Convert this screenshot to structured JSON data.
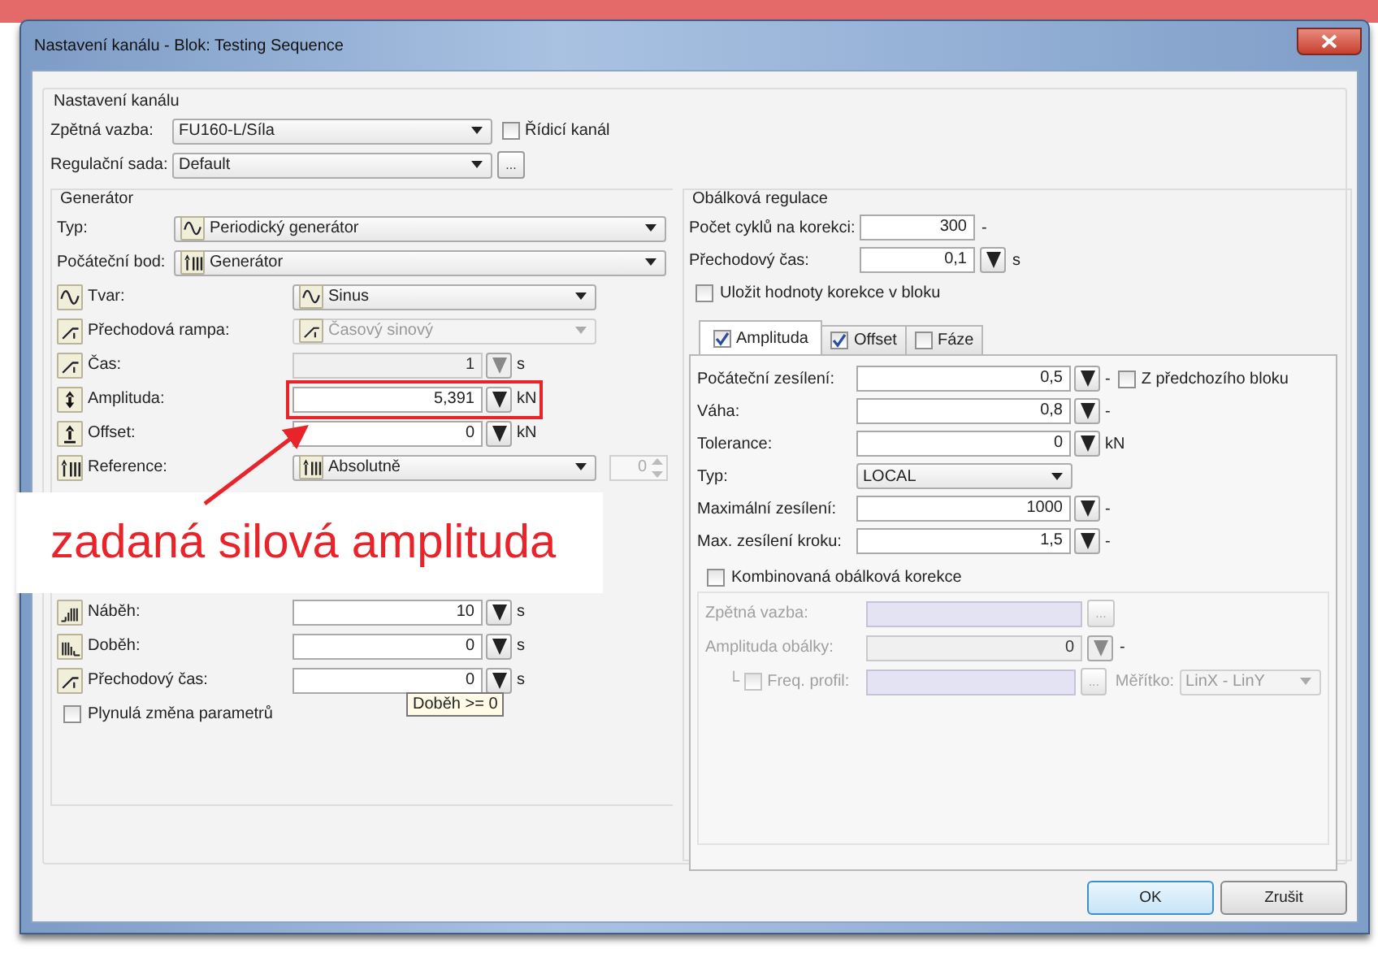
{
  "window": {
    "title": "Nastavení kanálu - Blok: Testing Sequence"
  },
  "channel": {
    "title": "Nastavení kanálu",
    "feedback": {
      "label": "Zpětná vazba:",
      "value": "FU160-L/Síla"
    },
    "control_channel": {
      "label": "Řídicí kanál",
      "checked": false
    },
    "control_set": {
      "label": "Regulační sada:",
      "value": "Default",
      "button": "..."
    }
  },
  "generator": {
    "title": "Generátor",
    "rows": [
      {
        "kind": "select",
        "label": "Typ:",
        "value": "Periodický generátor",
        "disabled": false,
        "highlighted": false
      },
      {
        "kind": "select",
        "label": "Počáteční bod:",
        "value": "Generátor",
        "disabled": false,
        "highlighted": false
      },
      {
        "kind": "select",
        "label": "Tvar:",
        "value": "Sinus",
        "disabled": false,
        "highlighted": false
      },
      {
        "kind": "select",
        "label": "Přechodová rampa:",
        "value": "Časový sinový",
        "disabled": true,
        "highlighted": false
      },
      {
        "kind": "number",
        "label": "Čas:",
        "value": "1",
        "unit": "s",
        "disabled": true,
        "highlighted": false
      },
      {
        "kind": "number",
        "label": "Amplituda:",
        "value": "5,391",
        "unit": "kN",
        "disabled": false,
        "highlighted": true
      },
      {
        "kind": "number",
        "label": "Offset:",
        "value": "0",
        "unit": "kN",
        "disabled": false,
        "highlighted": false
      },
      {
        "kind": "select",
        "label": "Reference:",
        "value": "Absolutně",
        "spinner": "0",
        "disabled": false,
        "highlighted": false
      }
    ],
    "rows_below": [
      {
        "kind": "number",
        "label": "Náběh:",
        "value": "10",
        "unit": "s",
        "disabled": false,
        "highlighted": false
      },
      {
        "kind": "number",
        "label": "Doběh:",
        "value": "0",
        "unit": "s",
        "disabled": false,
        "highlighted": false
      },
      {
        "kind": "number",
        "label": "Přechodový čas:",
        "value": "0",
        "unit": "s",
        "disabled": false,
        "highlighted": false
      }
    ],
    "tooltip": "Doběh >= 0",
    "smooth": {
      "label": "Plynulá změna parametrů",
      "checked": false
    }
  },
  "envelope": {
    "title": "Obálková regulace",
    "rows": [
      {
        "kind": "number",
        "label": "Počet cyklů na korekci:",
        "value": "300",
        "unit": "-",
        "spin": false
      },
      {
        "kind": "number",
        "label": "Přechodový čas:",
        "value": "0,1",
        "unit": "s",
        "spin": true
      }
    ],
    "save": {
      "label": "Uložit hodnoty korekce v bloku",
      "checked": false
    },
    "tabs": [
      {
        "label": "Amplituda",
        "checked": true,
        "selected": true
      },
      {
        "label": "Offset",
        "checked": true,
        "selected": false
      },
      {
        "label": "Fáze",
        "checked": false,
        "selected": false
      }
    ],
    "fields": [
      {
        "kind": "number",
        "label": "Počáteční zesílení:",
        "value": "0,5",
        "unit": "-",
        "option": {
          "label": "Z předchozího bloku",
          "checked": false
        }
      },
      {
        "kind": "number",
        "label": "Váha:",
        "value": "0,8",
        "unit": "-"
      },
      {
        "kind": "number",
        "label": "Tolerance:",
        "value": "0",
        "unit": "kN"
      },
      {
        "kind": "select",
        "label": "Typ:",
        "value": "LOCAL"
      },
      {
        "kind": "number",
        "label": "Maximální zesílení:",
        "value": "1000",
        "unit": "-"
      },
      {
        "kind": "number",
        "label": "Max. zesílení kroku:",
        "value": "1,5",
        "unit": "-"
      }
    ],
    "combined": {
      "label": "Kombinovaná obálková korekce",
      "checked": false,
      "rows": [
        {
          "kind": "picker",
          "label": "Zpětná vazba:",
          "button": "..."
        },
        {
          "kind": "number",
          "label": "Amplituda obálky:",
          "value": "0",
          "unit": "-"
        },
        {
          "kind": "freq",
          "branch": "└",
          "label": "Freq. profil:",
          "checked": false,
          "button": "...",
          "scale_label": "Měřítko:",
          "scale_value": "LinX - LinY"
        }
      ]
    }
  },
  "buttons": [
    {
      "label": "OK",
      "default": true
    },
    {
      "label": "Zrušit",
      "default": false
    }
  ],
  "annotation": {
    "text": "zadaná silová amplituda"
  }
}
